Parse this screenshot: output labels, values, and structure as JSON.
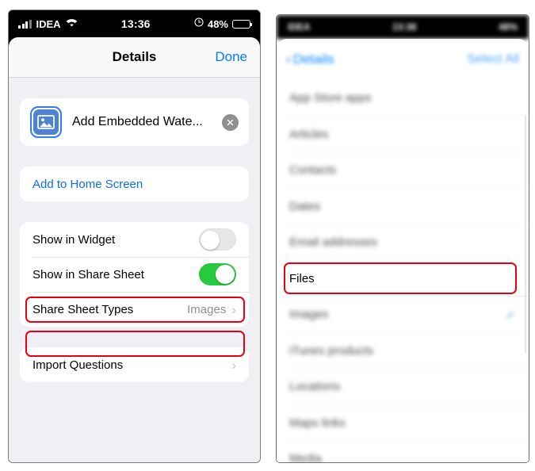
{
  "left_phone": {
    "status_bar": {
      "carrier": "IDEA",
      "time": "13:36",
      "battery_percent": "48%",
      "battery_level": 48,
      "signal_icon": "signal-bars-icon",
      "wifi_icon": "wifi-icon",
      "alarm_icon": "alarm-clock-icon",
      "battery_icon": "battery-icon"
    },
    "nav": {
      "title": "Details",
      "done_label": "Done"
    },
    "action_card": {
      "icon": "photo-image-icon",
      "label": "Add Embedded Wate...",
      "remove_icon": "close-circle-icon"
    },
    "home_screen_card": {
      "label": "Add to Home Screen"
    },
    "settings_rows": [
      {
        "label": "Show in Widget",
        "control": "toggle",
        "state": "off",
        "highlighted": false
      },
      {
        "label": "Show in Share Sheet",
        "control": "toggle",
        "state": "on",
        "highlighted": true
      },
      {
        "label": "Share Sheet Types",
        "control": "disclosure",
        "value": "Images",
        "chevron": "chevron-right-icon",
        "highlighted": true
      }
    ],
    "import_card": {
      "label": "Import Questions",
      "chevron": "chevron-right-icon"
    }
  },
  "right_phone": {
    "status_bar": {
      "carrier": "IDEA",
      "time": "13:36",
      "battery_percent": "48%"
    },
    "nav": {
      "back_icon": "chevron-left-icon",
      "back_label": "Details",
      "select_all_label": "Select All"
    },
    "list_items": [
      {
        "label": "App Store apps",
        "blurred": true,
        "checked": false
      },
      {
        "label": "Articles",
        "blurred": true,
        "checked": false
      },
      {
        "label": "Contacts",
        "blurred": true,
        "checked": false
      },
      {
        "label": "Dates",
        "blurred": true,
        "checked": false
      },
      {
        "label": "Email addresses",
        "blurred": true,
        "checked": false
      },
      {
        "label": "Files",
        "blurred": false,
        "checked": false,
        "highlighted": true
      },
      {
        "label": "Images",
        "blurred": true,
        "checked": true,
        "check_icon": "checkmark-icon"
      },
      {
        "label": "iTunes products",
        "blurred": true,
        "checked": false
      },
      {
        "label": "Locations",
        "blurred": true,
        "checked": false
      },
      {
        "label": "Maps links",
        "blurred": true,
        "checked": false
      },
      {
        "label": "Media",
        "blurred": true,
        "checked": false
      }
    ]
  },
  "colors": {
    "ios_blue": "#007aff",
    "toggle_green": "#28c93f",
    "annotation_red": "#e60012",
    "group_background": "#efeff4",
    "icon_blue": "#4f83d0"
  }
}
